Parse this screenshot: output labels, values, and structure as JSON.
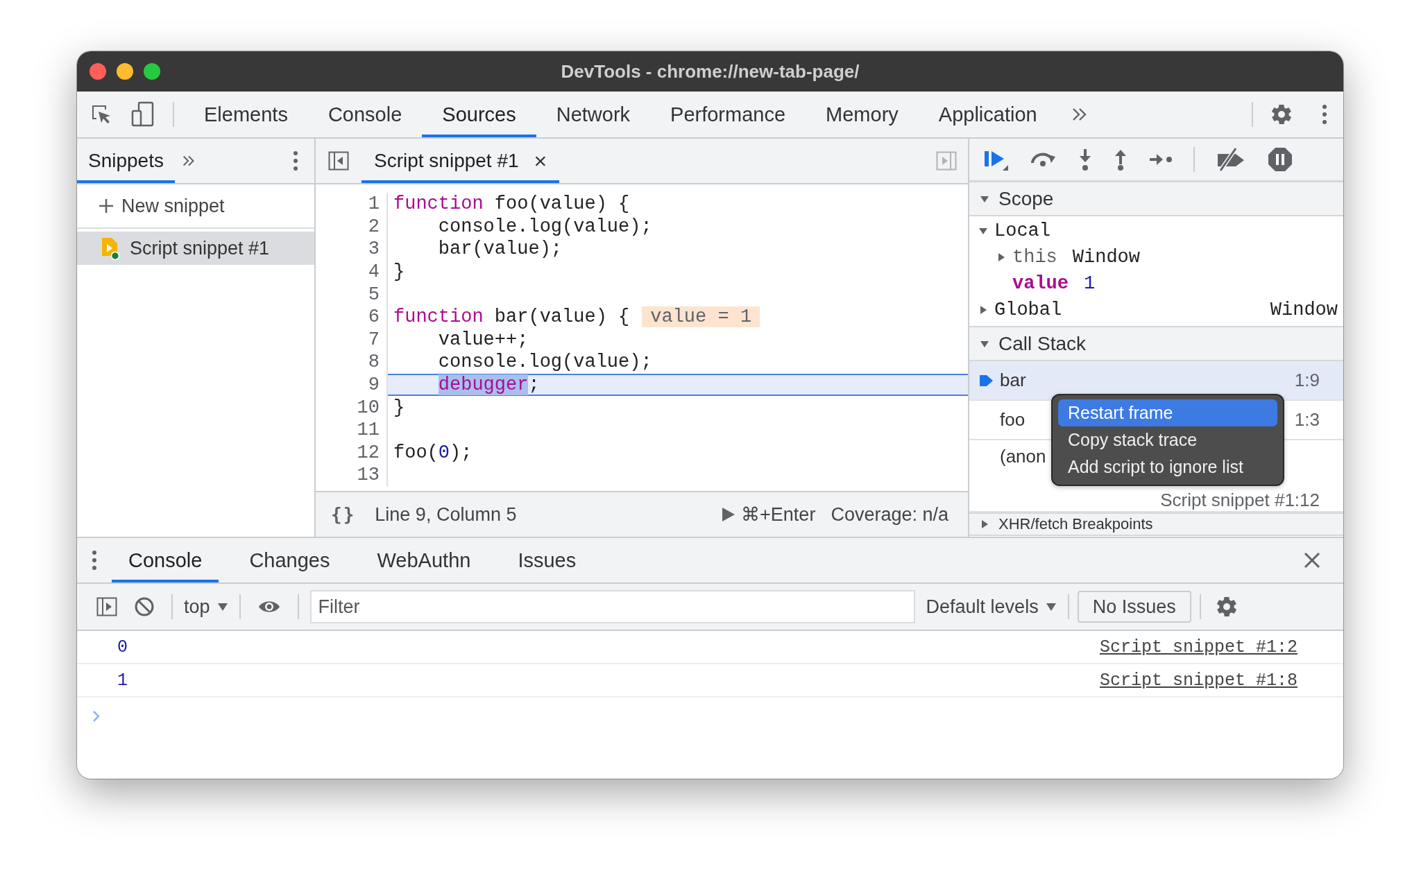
{
  "window": {
    "title": "DevTools - chrome://new-tab-page/"
  },
  "main_tabs": [
    {
      "label": "Elements",
      "selected": false
    },
    {
      "label": "Console",
      "selected": false
    },
    {
      "label": "Sources",
      "selected": true
    },
    {
      "label": "Network",
      "selected": false
    },
    {
      "label": "Performance",
      "selected": false
    },
    {
      "label": "Memory",
      "selected": false
    },
    {
      "label": "Application",
      "selected": false
    }
  ],
  "sidebar": {
    "tabs": [
      {
        "label": "Snippets",
        "selected": true
      }
    ],
    "new_snippet": "New snippet",
    "items": [
      {
        "name": "Script snippet #1",
        "selected": true
      }
    ]
  },
  "editor": {
    "tabs": [
      {
        "label": "Script snippet #1",
        "close": "×",
        "selected": true
      }
    ],
    "lines": [
      {
        "number": "1",
        "paused": false,
        "tokens": [
          {
            "text": "function",
            "kind": "keyword"
          },
          {
            "text": " foo(value) {",
            "kind": "plain"
          }
        ]
      },
      {
        "number": "2",
        "paused": false,
        "tokens": [
          {
            "text": "    console.log(value);",
            "kind": "plain"
          }
        ]
      },
      {
        "number": "3",
        "paused": false,
        "tokens": [
          {
            "text": "    bar(value);",
            "kind": "plain"
          }
        ]
      },
      {
        "number": "4",
        "paused": false,
        "tokens": [
          {
            "text": "}",
            "kind": "plain"
          }
        ]
      },
      {
        "number": "5",
        "paused": false
      },
      {
        "number": "6",
        "paused": false,
        "tokens": [
          {
            "text": "function",
            "kind": "keyword"
          },
          {
            "text": " bar(value) {",
            "kind": "plain"
          }
        ],
        "inline_value": "value = 1"
      },
      {
        "number": "7",
        "paused": false,
        "tokens": [
          {
            "text": "    value++;",
            "kind": "plain"
          }
        ]
      },
      {
        "number": "8",
        "paused": false,
        "tokens": [
          {
            "text": "    console.log(value);",
            "kind": "plain"
          }
        ]
      },
      {
        "number": "9",
        "paused": true,
        "indented": true,
        "tokens": [
          {
            "text": "debugger",
            "kind": "selected-keyword"
          },
          {
            "text": ";",
            "kind": "plain"
          }
        ]
      },
      {
        "number": "10",
        "paused": false,
        "tokens": [
          {
            "text": "}",
            "kind": "plain"
          }
        ]
      },
      {
        "number": "11",
        "paused": false
      },
      {
        "number": "12",
        "paused": false,
        "tokens": [
          {
            "text": "foo(",
            "kind": "plain"
          },
          {
            "text": "0",
            "kind": "number"
          },
          {
            "text": ");",
            "kind": "plain"
          }
        ]
      },
      {
        "number": "13",
        "paused": false
      }
    ],
    "status": {
      "format": "{}",
      "position": "Line 9, Column 5",
      "run": "⌘+Enter",
      "coverage": "Coverage: n/a"
    }
  },
  "scope": {
    "title": "Scope",
    "expanded": true,
    "groups": [
      {
        "name": "Local",
        "expanded": true,
        "children": [
          {
            "name": "this",
            "value": "Window",
            "kind": "object",
            "expanded": false
          },
          {
            "name": "value",
            "value": "1",
            "kind": "property"
          }
        ]
      },
      {
        "name": "Global",
        "expanded": false,
        "value": "Window"
      }
    ]
  },
  "call_stack": {
    "title": "Call Stack",
    "expanded": true,
    "frames": [
      {
        "function": "bar",
        "location": "1:9",
        "selected": true,
        "current": true,
        "wrapped": false
      },
      {
        "function": "foo",
        "location": "1:3",
        "selected": false,
        "current": false,
        "wrapped": false
      },
      {
        "function": "(anon",
        "location": "Script snippet #1:12",
        "selected": false,
        "current": false,
        "wrapped": true
      }
    ]
  },
  "xhr_breakpoints": {
    "title": "XHR/fetch Breakpoints",
    "expanded": false
  },
  "context_menu": [
    {
      "label": "Restart frame",
      "selected": true
    },
    {
      "label": "Copy stack trace",
      "selected": false
    },
    {
      "label": "Add script to ignore list",
      "selected": false
    }
  ],
  "drawer": {
    "tabs": [
      {
        "label": "Console",
        "selected": true
      },
      {
        "label": "Changes",
        "selected": false
      },
      {
        "label": "WebAuthn",
        "selected": false
      },
      {
        "label": "Issues",
        "selected": false
      }
    ],
    "context": "top",
    "filter": {
      "placeholder": "Filter"
    },
    "levels": "Default levels",
    "issues": "No Issues",
    "messages": [
      {
        "value": "0",
        "source": "Script snippet #1:2"
      },
      {
        "value": "1",
        "source": "Script snippet #1:8"
      }
    ]
  }
}
